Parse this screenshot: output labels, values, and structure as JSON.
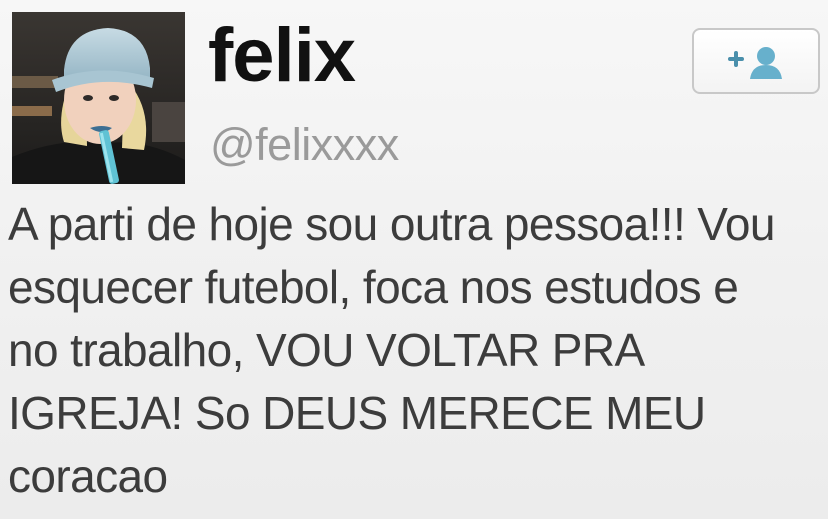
{
  "user": {
    "display_name": "felix",
    "handle": "@felixxxx",
    "avatar_icon": "profile-photo"
  },
  "actions": {
    "follow_icon": "add-user-icon"
  },
  "tweet": {
    "lines": [
      "A parti de hoje sou outra pessoa!!! Vou",
      "esquecer futebol, foca nos estudos e",
      "no trabalho, VOU VOLTAR PRA",
      "IGREJA! So DEUS MERECE MEU",
      "coracao"
    ]
  },
  "colors": {
    "name": "#111111",
    "handle": "#9a9a9a",
    "text": "#3c3c3c",
    "accent": "#67b0cc"
  }
}
